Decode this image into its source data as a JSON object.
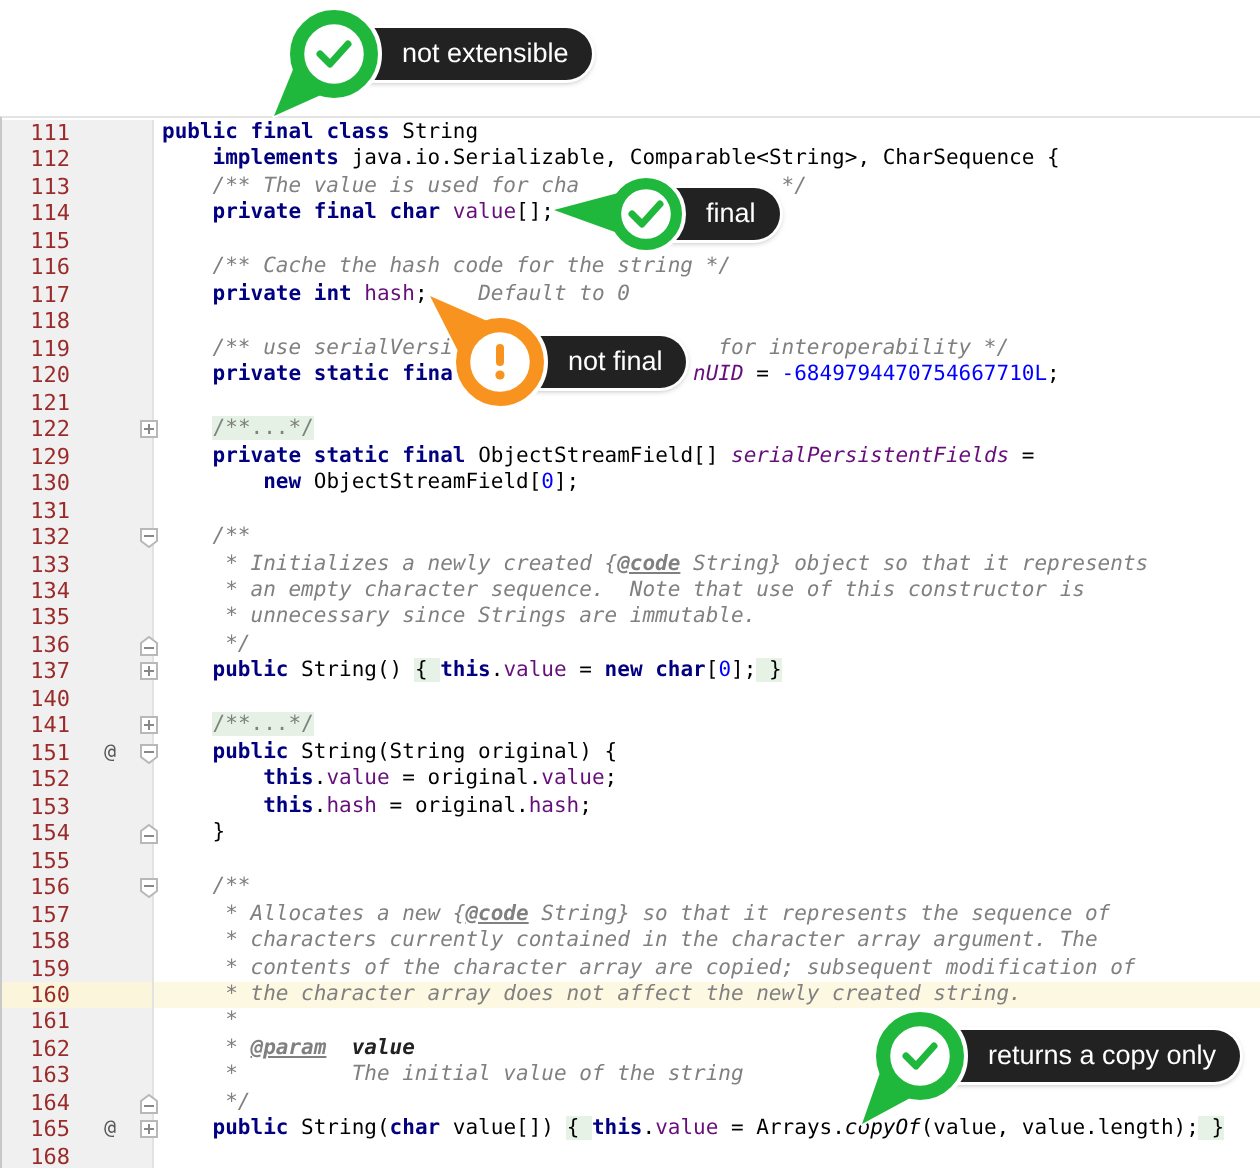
{
  "editor": {
    "lines": [
      {
        "number": "111",
        "current": false,
        "pieces": [
          [
            {
              "kind": "keyword",
              "text": "public"
            },
            {
              "kind": "keyword",
              "text": " final"
            },
            {
              "kind": "keyword",
              "text": " class"
            },
            {
              "kind": "plain",
              "text": " String"
            }
          ]
        ]
      },
      {
        "number": "112",
        "current": false,
        "pieces": [
          [
            {
              "kind": "keyword",
              "text": "    implements"
            },
            {
              "kind": "plain",
              "text": " java.io.Serializable, Comparable<String>, CharSequence {"
            }
          ]
        ]
      },
      {
        "number": "113",
        "current": false,
        "pieces": [
          [
            {
              "kind": "comment",
              "text": "    /** The value is used for cha"
            }
          ],
          [
            {
              "kind": "comment",
              "text": "*/"
            }
          ]
        ]
      },
      {
        "number": "114",
        "current": false,
        "pieces": [
          [
            {
              "kind": "keyword",
              "text": "    private"
            },
            {
              "kind": "keyword",
              "text": " final"
            },
            {
              "kind": "keyword",
              "text": " char"
            },
            {
              "kind": "field",
              "text": " value"
            },
            {
              "kind": "plain",
              "text": "[];"
            }
          ]
        ]
      },
      {
        "number": "115",
        "current": false
      },
      {
        "number": "116",
        "current": false,
        "pieces": [
          [
            {
              "kind": "comment",
              "text": "    /** Cache the hash code for the string */"
            }
          ]
        ]
      },
      {
        "number": "117",
        "current": false,
        "pieces": [
          [
            {
              "kind": "keyword",
              "text": "    private"
            },
            {
              "kind": "keyword",
              "text": " int"
            },
            {
              "kind": "field",
              "text": " hash"
            },
            {
              "kind": "plain",
              "text": ";"
            }
          ],
          [
            {
              "kind": "comment",
              "text": "Default to 0"
            }
          ]
        ]
      },
      {
        "number": "118",
        "current": false
      },
      {
        "number": "119",
        "current": false,
        "pieces": [
          [
            {
              "kind": "comment",
              "text": "    /** use serialVersi"
            }
          ],
          [
            {
              "kind": "comment",
              "text": "for interoperability */"
            }
          ]
        ]
      },
      {
        "number": "120",
        "current": false,
        "pieces": [
          [
            {
              "kind": "keyword",
              "text": "    private"
            },
            {
              "kind": "keyword",
              "text": " static"
            },
            {
              "kind": "keyword",
              "text": " fina"
            }
          ],
          [
            {
              "kind": "static",
              "text": "nUID"
            },
            {
              "kind": "plain",
              "text": " = "
            },
            {
              "kind": "number",
              "text": "-6849794470754667710L"
            },
            {
              "kind": "plain",
              "text": ";"
            }
          ]
        ]
      },
      {
        "number": "121",
        "current": false
      },
      {
        "number": "122",
        "current": false,
        "fold": {
          "kind": "collapsed"
        },
        "pieces": [
          [
            {
              "kind": "folded",
              "text": "    /**...*/"
            }
          ]
        ]
      },
      {
        "number": "129",
        "current": false,
        "pieces": [
          [
            {
              "kind": "keyword",
              "text": "    private"
            },
            {
              "kind": "keyword",
              "text": " static"
            },
            {
              "kind": "keyword",
              "text": " final"
            },
            {
              "kind": "plain",
              "text": " ObjectStreamField[] "
            },
            {
              "kind": "static",
              "text": "serialPersistentFields"
            },
            {
              "kind": "plain",
              "text": " ="
            }
          ]
        ]
      },
      {
        "number": "130",
        "current": false,
        "pieces": [
          [
            {
              "kind": "keyword",
              "text": "        new"
            },
            {
              "kind": "plain",
              "text": " ObjectStreamField["
            },
            {
              "kind": "number",
              "text": "0"
            },
            {
              "kind": "plain",
              "text": "];"
            }
          ]
        ]
      },
      {
        "number": "131",
        "current": false
      },
      {
        "number": "132",
        "current": false,
        "fold": {
          "kind": "open"
        },
        "pieces": [
          [
            {
              "kind": "comment",
              "text": "    /**"
            }
          ]
        ]
      },
      {
        "number": "133",
        "current": false,
        "pieces": [
          [
            {
              "kind": "comment",
              "text": "     * Initializes a newly created {"
            },
            {
              "kind": "doctag",
              "text": "@code"
            },
            {
              "kind": "comment",
              "text": " String} object so that it represents"
            }
          ]
        ]
      },
      {
        "number": "134",
        "current": false,
        "pieces": [
          [
            {
              "kind": "comment",
              "text": "     * an empty character sequence.  Note that use of this constructor is"
            }
          ]
        ]
      },
      {
        "number": "135",
        "current": false,
        "pieces": [
          [
            {
              "kind": "comment",
              "text": "     * unnecessary since Strings are immutable."
            }
          ]
        ]
      },
      {
        "number": "136",
        "current": false,
        "fold": {
          "kind": "close"
        },
        "pieces": [
          [
            {
              "kind": "comment",
              "text": "     */"
            }
          ]
        ]
      },
      {
        "number": "137",
        "current": false,
        "fold": {
          "kind": "collapsed"
        },
        "pieces": [
          [
            {
              "kind": "keyword",
              "text": "    public"
            },
            {
              "kind": "plain",
              "text": " String() "
            },
            {
              "kind": "brace",
              "text": "{ "
            },
            {
              "kind": "keyword",
              "text": "this"
            },
            {
              "kind": "member",
              "text": ".value"
            },
            {
              "kind": "plain",
              "text": " = "
            },
            {
              "kind": "keyword",
              "text": "new"
            },
            {
              "kind": "keyword",
              "text": " char"
            },
            {
              "kind": "plain",
              "text": "["
            },
            {
              "kind": "number",
              "text": "0"
            },
            {
              "kind": "plain",
              "text": "];"
            },
            {
              "kind": "brace",
              "text": " }"
            }
          ]
        ]
      },
      {
        "number": "140",
        "current": false
      },
      {
        "number": "141",
        "current": false,
        "fold": {
          "kind": "collapsed"
        },
        "pieces": [
          [
            {
              "kind": "folded",
              "text": "    /**...*/"
            }
          ]
        ]
      },
      {
        "number": "151",
        "current": false,
        "marker": "@",
        "fold": {
          "kind": "open"
        },
        "pieces": [
          [
            {
              "kind": "keyword",
              "text": "    public"
            },
            {
              "kind": "plain",
              "text": " String(String original) {"
            }
          ]
        ]
      },
      {
        "number": "152",
        "current": false,
        "pieces": [
          [
            {
              "kind": "keyword",
              "text": "        this"
            },
            {
              "kind": "member",
              "text": ".value"
            },
            {
              "kind": "plain",
              "text": " = original."
            },
            {
              "kind": "field",
              "text": "value"
            },
            {
              "kind": "plain",
              "text": ";"
            }
          ]
        ]
      },
      {
        "number": "153",
        "current": false,
        "pieces": [
          [
            {
              "kind": "keyword",
              "text": "        this"
            },
            {
              "kind": "member",
              "text": ".hash"
            },
            {
              "kind": "plain",
              "text": " = original."
            },
            {
              "kind": "field",
              "text": "hash"
            },
            {
              "kind": "plain",
              "text": ";"
            }
          ]
        ]
      },
      {
        "number": "154",
        "current": false,
        "fold": {
          "kind": "close"
        },
        "pieces": [
          [
            {
              "kind": "plain",
              "text": "    }"
            }
          ]
        ]
      },
      {
        "number": "155",
        "current": false
      },
      {
        "number": "156",
        "current": false,
        "fold": {
          "kind": "open"
        },
        "pieces": [
          [
            {
              "kind": "comment",
              "text": "    /**"
            }
          ]
        ]
      },
      {
        "number": "157",
        "current": false,
        "pieces": [
          [
            {
              "kind": "comment",
              "text": "     * Allocates a new {"
            },
            {
              "kind": "doctag",
              "text": "@code"
            },
            {
              "kind": "comment",
              "text": " String} so that it represents the sequence of"
            }
          ]
        ]
      },
      {
        "number": "158",
        "current": false,
        "pieces": [
          [
            {
              "kind": "comment",
              "text": "     * characters currently contained in the character array argument. The"
            }
          ]
        ]
      },
      {
        "number": "159",
        "current": false,
        "pieces": [
          [
            {
              "kind": "comment",
              "text": "     * contents of the character array are copied; subsequent modification of"
            }
          ]
        ]
      },
      {
        "number": "160",
        "current": true,
        "pieces": [
          [
            {
              "kind": "comment",
              "text": "     * the character array does not affect the newly created string."
            }
          ]
        ]
      },
      {
        "number": "161",
        "current": false,
        "pieces": [
          [
            {
              "kind": "comment",
              "text": "     *"
            }
          ]
        ]
      },
      {
        "number": "162",
        "current": false,
        "pieces": [
          [
            {
              "kind": "comment",
              "text": "     * "
            },
            {
              "kind": "doctag",
              "text": "@param"
            },
            {
              "kind": "docname",
              "text": "  value"
            }
          ]
        ]
      },
      {
        "number": "163",
        "current": false,
        "pieces": [
          [
            {
              "kind": "comment",
              "text": "     *         The initial value of the string"
            }
          ]
        ]
      },
      {
        "number": "164",
        "current": false,
        "fold": {
          "kind": "close"
        },
        "pieces": [
          [
            {
              "kind": "comment",
              "text": "     */"
            }
          ]
        ]
      },
      {
        "number": "165",
        "current": false,
        "marker": "@",
        "fold": {
          "kind": "collapsed"
        },
        "pieces": [
          [
            {
              "kind": "keyword",
              "text": "    public"
            },
            {
              "kind": "plain",
              "text": " String("
            },
            {
              "kind": "keyword",
              "text": "char"
            },
            {
              "kind": "plain",
              "text": " value[]) "
            },
            {
              "kind": "brace",
              "text": "{ "
            },
            {
              "kind": "keyword",
              "text": "this"
            },
            {
              "kind": "member",
              "text": ".value"
            },
            {
              "kind": "plain",
              "text": " = Arrays."
            },
            {
              "kind": "italic",
              "text": "copyOf"
            },
            {
              "kind": "plain",
              "text": "(value, value.length);"
            },
            {
              "kind": "brace",
              "text": " }"
            }
          ]
        ]
      },
      {
        "number": "168",
        "current": false
      }
    ]
  },
  "callouts": [
    {
      "kind": "check",
      "text": "not extensible"
    },
    {
      "kind": "check",
      "text": "final"
    },
    {
      "kind": "warning",
      "text": "not final"
    },
    {
      "kind": "check",
      "text": "returns a copy only"
    }
  ]
}
